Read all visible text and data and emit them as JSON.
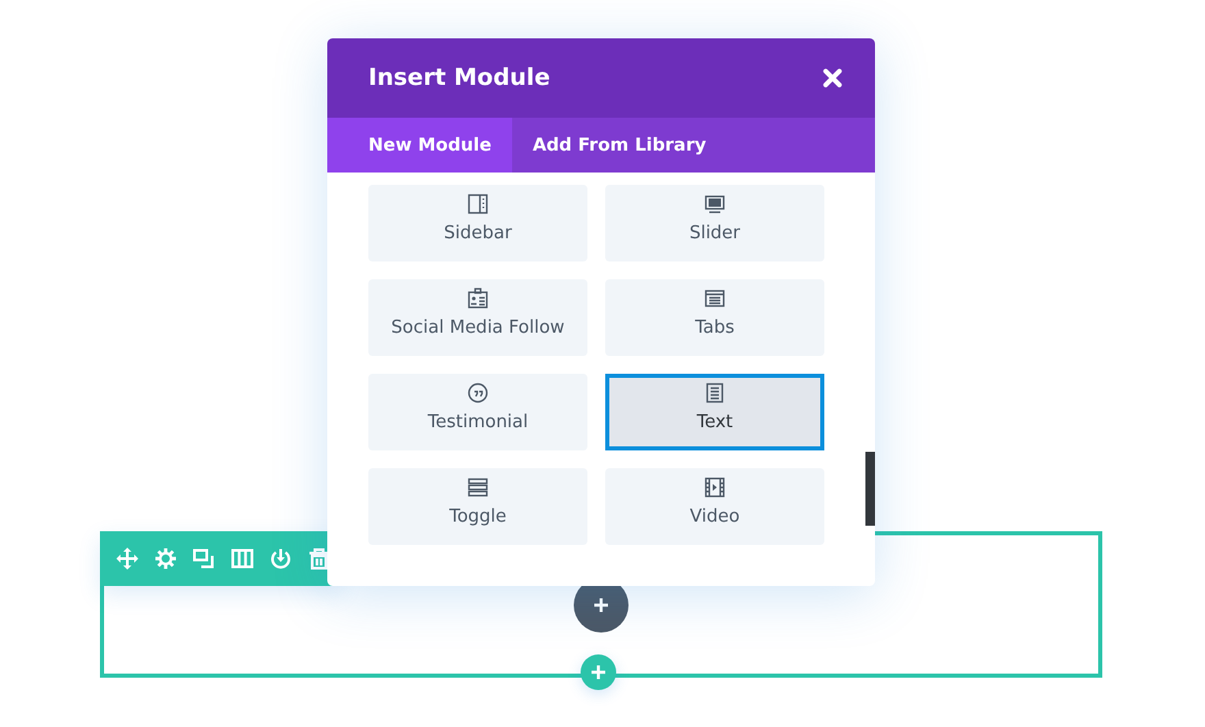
{
  "modal": {
    "title": "Insert Module",
    "tabs": [
      {
        "label": "New Module",
        "selected": true
      },
      {
        "label": "Add From Library",
        "selected": false
      }
    ],
    "modules": [
      {
        "label": "Sidebar",
        "selected": false
      },
      {
        "label": "Slider",
        "selected": false
      },
      {
        "label": "Social Media Follow",
        "selected": false
      },
      {
        "label": "Tabs",
        "selected": false
      },
      {
        "label": "Testimonial",
        "selected": false
      },
      {
        "label": "Text",
        "selected": true
      },
      {
        "label": "Toggle",
        "selected": false
      },
      {
        "label": "Video",
        "selected": false
      }
    ]
  }
}
